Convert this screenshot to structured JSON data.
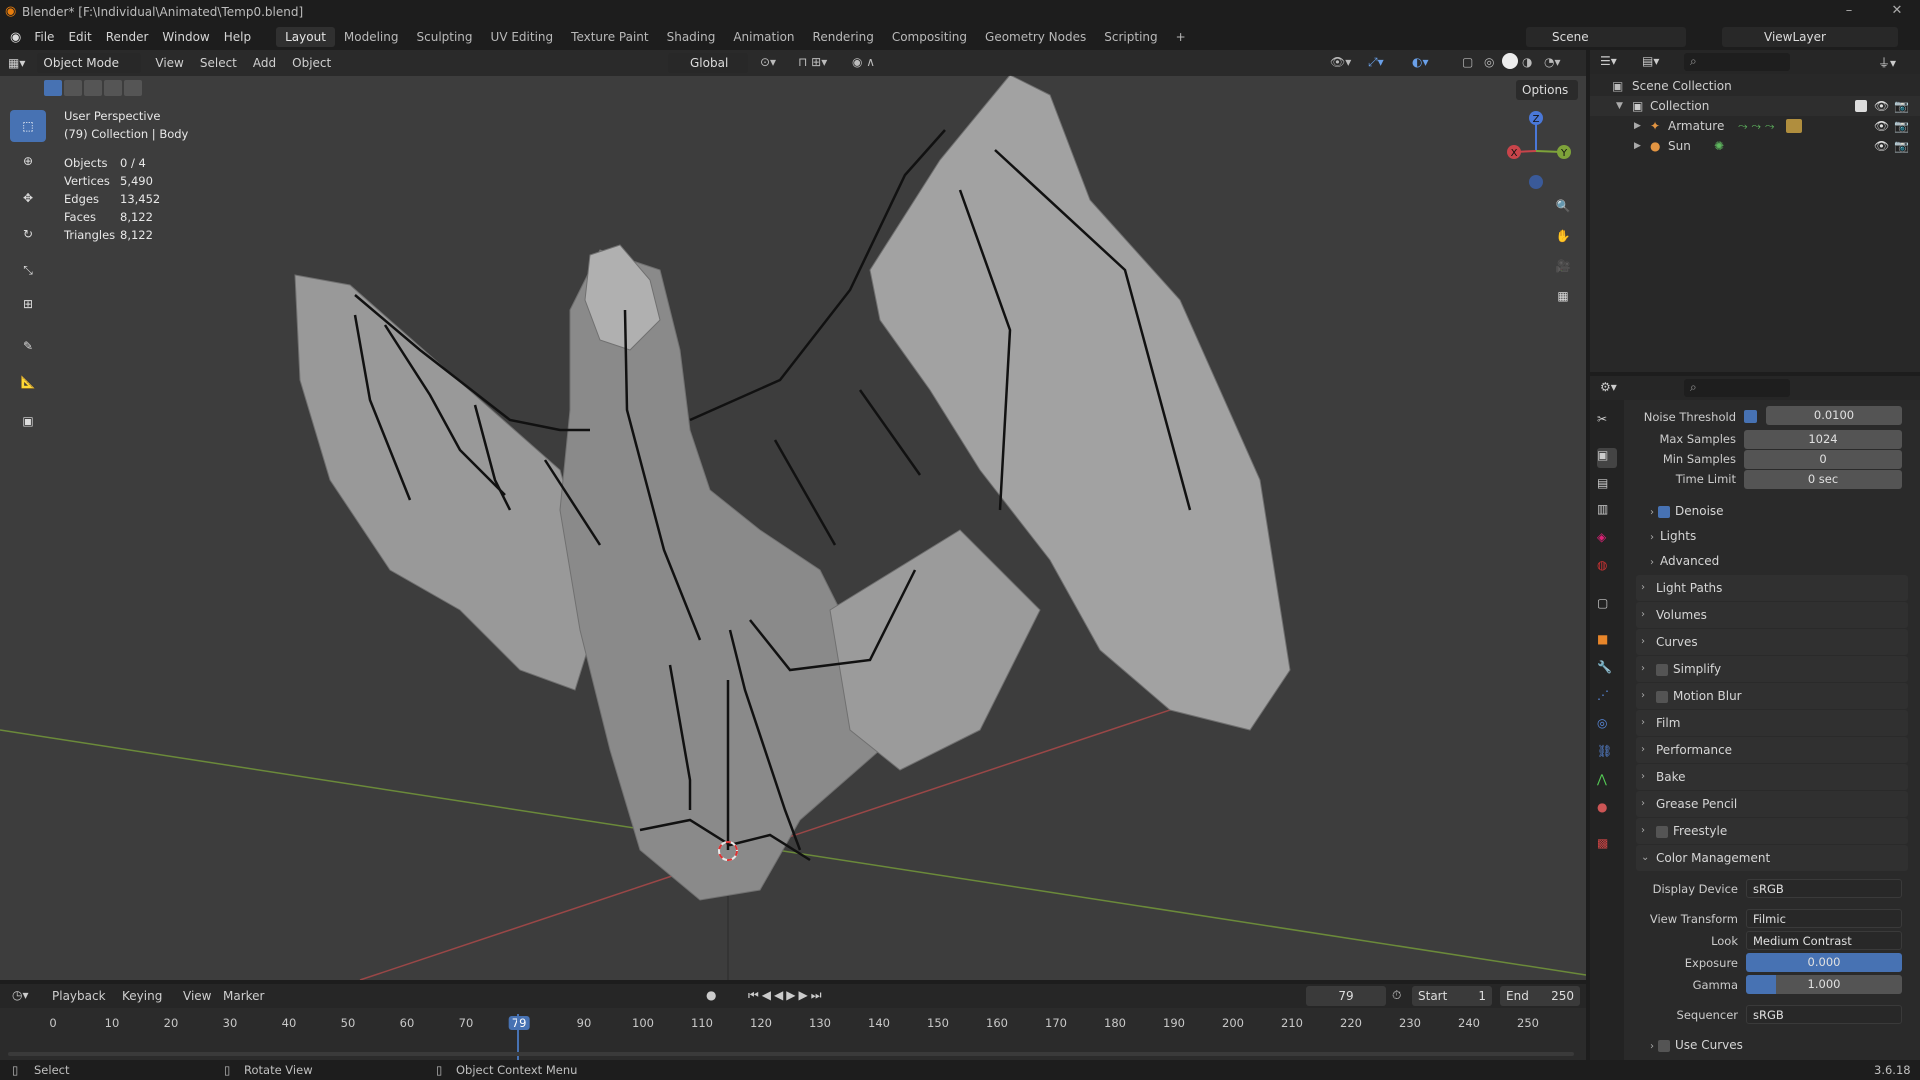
{
  "window": {
    "title": "Blender* [F:\\Individual\\Animated\\Temp0.blend]"
  },
  "menu": [
    "File",
    "Edit",
    "Render",
    "Window",
    "Help"
  ],
  "workspaces": [
    "Layout",
    "Modeling",
    "Sculpting",
    "UV Editing",
    "Texture Paint",
    "Shading",
    "Animation",
    "Rendering",
    "Compositing",
    "Geometry Nodes",
    "Scripting",
    "+"
  ],
  "active_workspace": "Layout",
  "scene": {
    "label": "Scene",
    "view_layer": "ViewLayer"
  },
  "viewport": {
    "mode": "Object Mode",
    "menus": [
      "View",
      "Select",
      "Add",
      "Object"
    ],
    "orientation": "Global",
    "options_label": "Options",
    "perspective": "User Perspective",
    "context": "(79) Collection | Body",
    "stats": [
      {
        "label": "Objects",
        "value": "0 / 4"
      },
      {
        "label": "Vertices",
        "value": "5,490"
      },
      {
        "label": "Edges",
        "value": "13,452"
      },
      {
        "label": "Faces",
        "value": "8,122"
      },
      {
        "label": "Triangles",
        "value": "8,122"
      }
    ],
    "gizmo": {
      "x": "X",
      "y": "Y",
      "z": "Z"
    }
  },
  "outliner": {
    "root": "Scene Collection",
    "items": [
      {
        "name": "Collection",
        "level": 1
      },
      {
        "name": "Armature",
        "level": 2
      },
      {
        "name": "Sun",
        "level": 2
      }
    ]
  },
  "properties": {
    "noise_threshold": {
      "label": "Noise Threshold",
      "value": "0.0100"
    },
    "max_samples": {
      "label": "Max Samples",
      "value": "1024"
    },
    "min_samples": {
      "label": "Min Samples",
      "value": "0"
    },
    "time_limit": {
      "label": "Time Limit",
      "value": "0 sec"
    },
    "subs": [
      "Denoise",
      "Lights",
      "Advanced"
    ],
    "sections": [
      "Light Paths",
      "Volumes",
      "Curves",
      "Simplify",
      "Motion Blur",
      "Film",
      "Performance",
      "Bake",
      "Grease Pencil",
      "Freestyle",
      "Color Management"
    ],
    "color_management": {
      "display_device": {
        "label": "Display Device",
        "value": "sRGB"
      },
      "view_transform": {
        "label": "View Transform",
        "value": "Filmic"
      },
      "look": {
        "label": "Look",
        "value": "Medium Contrast"
      },
      "exposure": {
        "label": "Exposure",
        "value": "0.000"
      },
      "gamma": {
        "label": "Gamma",
        "value": "1.000"
      },
      "sequencer": {
        "label": "Sequencer",
        "value": "sRGB"
      },
      "use_curves": "Use Curves"
    }
  },
  "timeline": {
    "menus": [
      "Playback",
      "Keying",
      "View",
      "Marker"
    ],
    "current_frame": "79",
    "start_label": "Start",
    "start": "1",
    "end_label": "End",
    "end": "250",
    "ticks": [
      "0",
      "10",
      "20",
      "30",
      "40",
      "50",
      "60",
      "70",
      "79",
      "90",
      "100",
      "110",
      "120",
      "130",
      "140",
      "150",
      "160",
      "170",
      "180",
      "190",
      "200",
      "210",
      "220",
      "230",
      "240",
      "250"
    ]
  },
  "status": {
    "select": "Select",
    "rotate": "Rotate View",
    "context_menu": "Object Context Menu",
    "version": "3.6.18"
  },
  "colors": {
    "accent": "#4772b3",
    "viewport_bg": "#3d3d3d",
    "panel": "#2a2a2a"
  }
}
